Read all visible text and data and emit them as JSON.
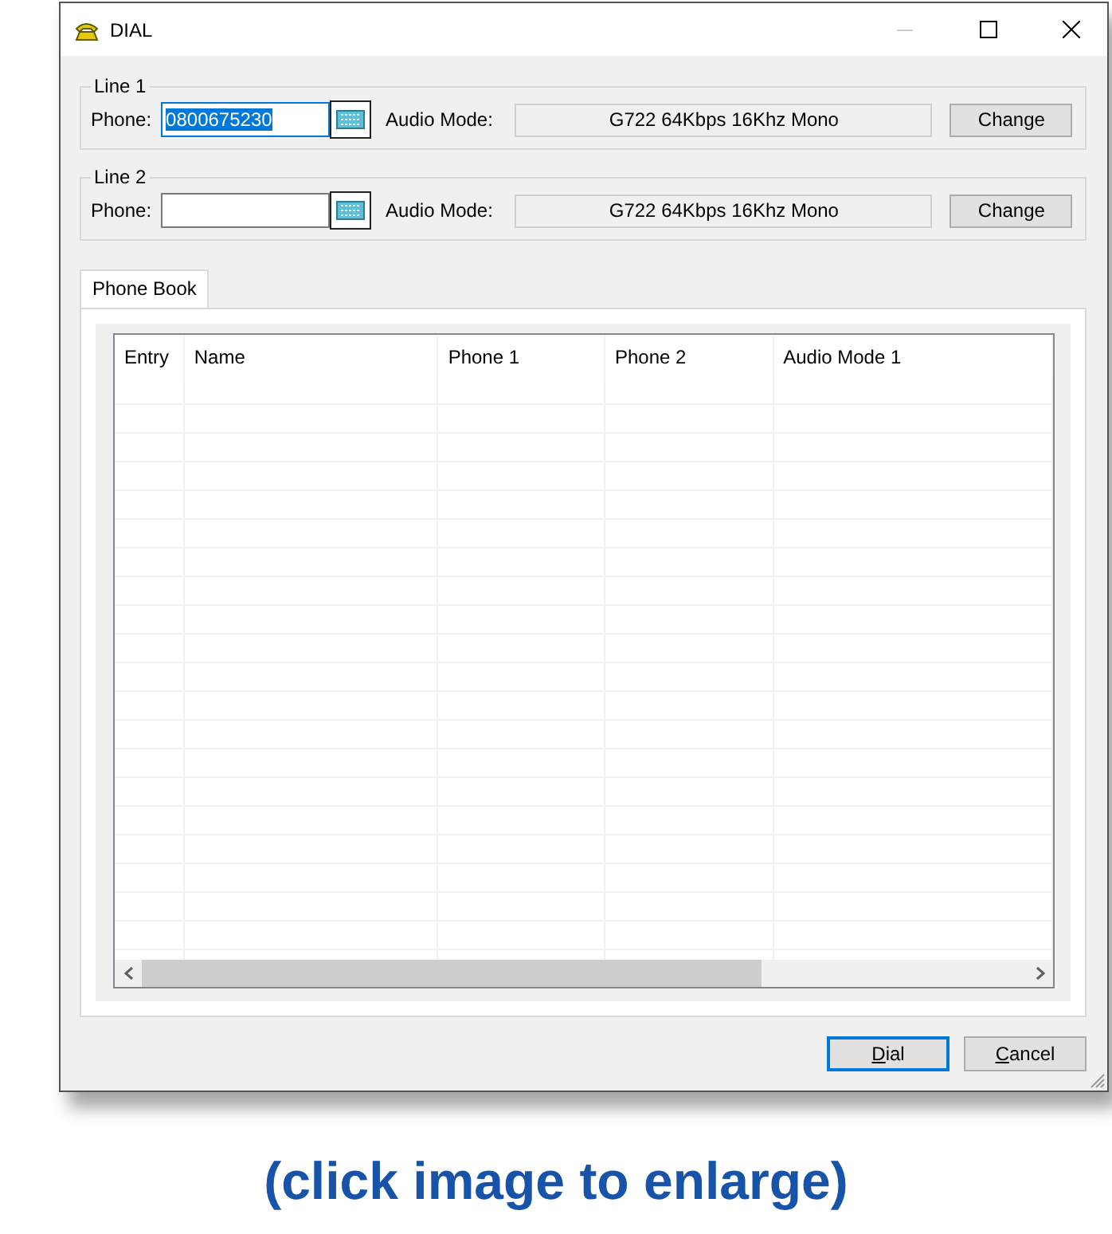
{
  "window": {
    "title": "DIAL"
  },
  "lines": [
    {
      "legend": "Line 1",
      "phone_label": "Phone:",
      "phone_value": "0800675230",
      "phone_selected": true,
      "audio_label": "Audio Mode:",
      "audio_mode": "G722 64Kbps 16Khz Mono",
      "button": "Change"
    },
    {
      "legend": "Line 2",
      "phone_label": "Phone:",
      "phone_selected": false,
      "audio_label": "Audio Mode:",
      "audio_mode": "G722 64Kbps 16Khz Mono",
      "button": "Change"
    }
  ],
  "tabs": [
    {
      "label": "Phone Book",
      "selected": true
    }
  ],
  "table": {
    "columns": [
      "Entry",
      "Name",
      "Phone 1",
      "Phone 2",
      "Audio Mode 1"
    ]
  },
  "buttons": [
    {
      "label": "Dial",
      "default": true,
      "mnemonic": true
    },
    {
      "label": "Cancel",
      "default": false,
      "mnemonic": true
    }
  ],
  "caption": "(click image to enlarge)"
}
